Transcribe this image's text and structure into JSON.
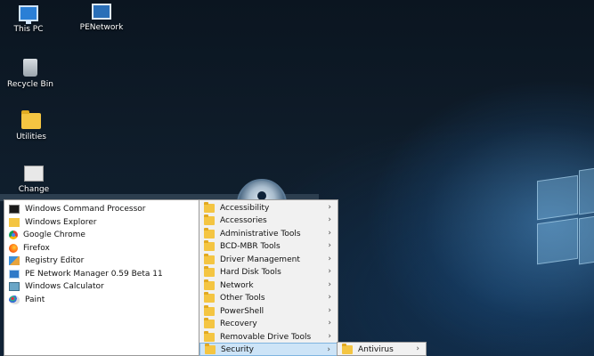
{
  "desktop": {
    "icons": [
      {
        "label": "This PC",
        "icon": "computer-icon"
      },
      {
        "label": "PENetwork",
        "icon": "network-icon"
      },
      {
        "label": "Recycle Bin",
        "icon": "recycle-bin-icon"
      },
      {
        "label": "Utilities",
        "icon": "folder-icon"
      },
      {
        "label": "Change Keyboard Layout",
        "icon": "keyboard-icon"
      }
    ]
  },
  "start_menu": {
    "programs": [
      {
        "label": "Windows Command Processor",
        "icon": "cmd-icon"
      },
      {
        "label": "Windows Explorer",
        "icon": "explorer-icon"
      },
      {
        "label": "Google Chrome",
        "icon": "chrome-icon"
      },
      {
        "label": "Firefox",
        "icon": "firefox-icon"
      },
      {
        "label": "Registry Editor",
        "icon": "registry-icon"
      },
      {
        "label": "PE Network Manager 0.59 Beta 11",
        "icon": "network-manager-icon"
      },
      {
        "label": "Windows Calculator",
        "icon": "calculator-icon"
      },
      {
        "label": "Paint",
        "icon": "paint-icon"
      }
    ],
    "folders": [
      {
        "label": "Accessibility"
      },
      {
        "label": "Accessories"
      },
      {
        "label": "Administrative Tools"
      },
      {
        "label": "BCD-MBR Tools"
      },
      {
        "label": "Driver Management"
      },
      {
        "label": "Hard Disk Tools"
      },
      {
        "label": "Network"
      },
      {
        "label": "Other Tools"
      },
      {
        "label": "PowerShell"
      },
      {
        "label": "Recovery"
      },
      {
        "label": "Removable Drive Tools"
      },
      {
        "label": "Security"
      }
    ],
    "security_submenu": [
      {
        "label": "Antivirus"
      }
    ],
    "arrow_glyph": "›"
  }
}
